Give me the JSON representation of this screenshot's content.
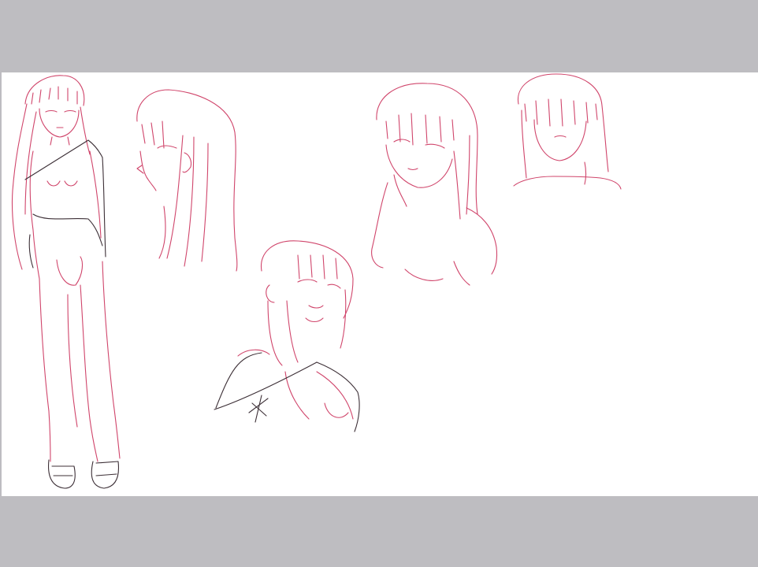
{
  "colors": {
    "letterbox": "#bebdc1",
    "paper": "#ffffff",
    "sketch_red": "#d0456b",
    "sketch_dark": "#3c2f36"
  },
  "icons": {
    "artwork": "character-sketch-sheet"
  }
}
